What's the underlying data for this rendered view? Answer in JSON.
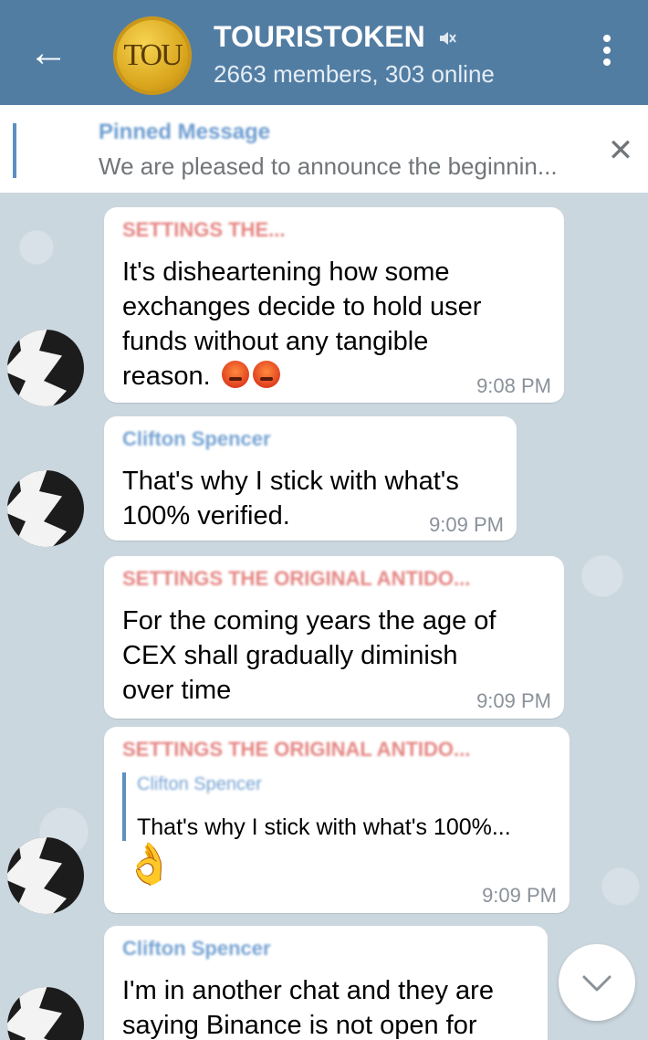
{
  "header": {
    "back_icon": "arrow-left-icon",
    "logo_text": "TOU",
    "title": "TOURISTOKEN",
    "mute_icon": "muted-speaker-icon",
    "subtitle": "2663 members, 303 online",
    "menu_icon": "more-vertical-icon",
    "color": "#527da3"
  },
  "pinned": {
    "title": "Pinned Message",
    "text": "We are pleased to announce the beginnin...",
    "close_icon": "close-icon"
  },
  "messages": [
    {
      "sender": "SETTINGS THE...",
      "text_lines": [
        "It's disheartening how some",
        "exchanges decide to hold user",
        "funds without any tangible",
        "reason."
      ],
      "emoji": "angry-face-icon",
      "time": "9:08 PM"
    },
    {
      "sender": "Clifton Spencer",
      "text_lines": [
        "That's why I stick with what's",
        "100% verified."
      ],
      "time": "9:09 PM"
    },
    {
      "sender": "SETTINGS THE ORIGINAL ANTIDO...",
      "text_lines": [
        "For the coming years the age of",
        "CEX shall gradually diminish",
        "over time"
      ],
      "time": "9:09 PM"
    },
    {
      "sender": "SETTINGS THE ORIGINAL ANTIDO...",
      "reply_name": "Clifton Spencer",
      "reply_text": "That's why I stick with what's 100%...",
      "emoji": "ok-hand-icon",
      "time": "9:09 PM"
    },
    {
      "sender": "Clifton Spencer",
      "text_lines": [
        "I'm in another chat and they are",
        "saying Binance is not open for"
      ]
    }
  ],
  "scroll_down_icon": "chevron-down-icon"
}
